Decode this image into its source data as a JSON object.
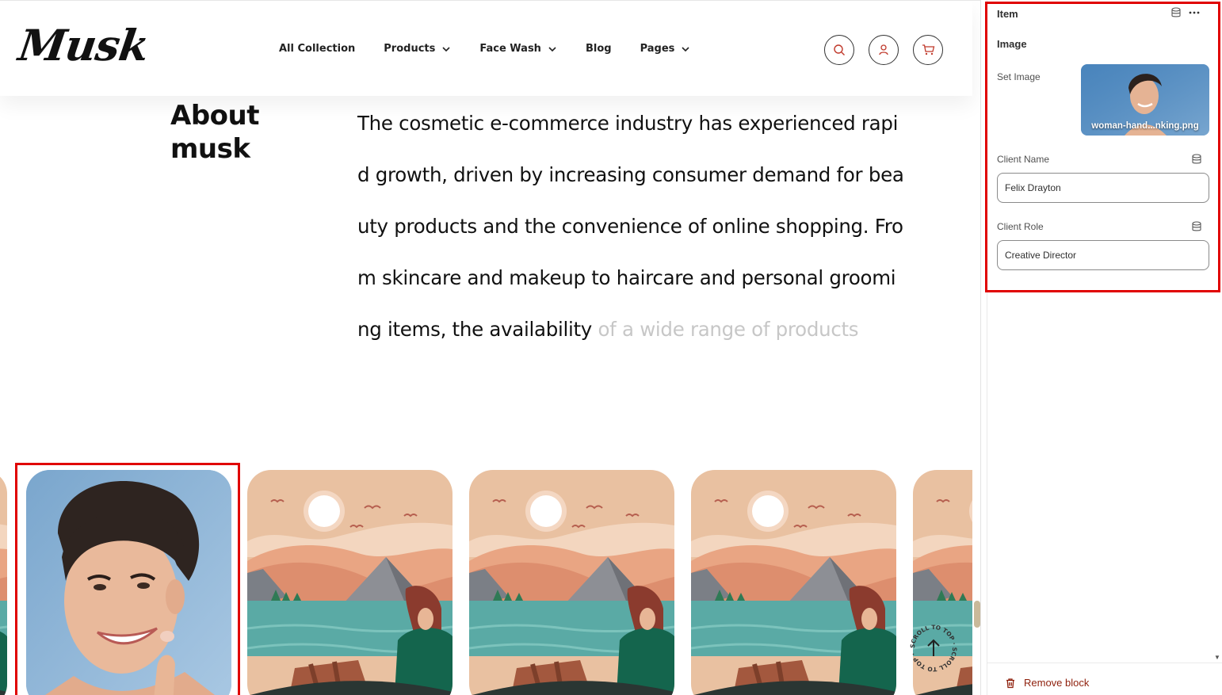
{
  "store": {
    "logo": "Musk",
    "nav": [
      {
        "label": "All Collection",
        "has_dropdown": false
      },
      {
        "label": "Products",
        "has_dropdown": true
      },
      {
        "label": "Face Wash",
        "has_dropdown": true
      },
      {
        "label": "Blog",
        "has_dropdown": false
      },
      {
        "label": "Pages",
        "has_dropdown": true
      }
    ],
    "header_icons": [
      "search-icon",
      "account-icon",
      "cart-icon"
    ],
    "about": {
      "title": "About musk",
      "text": "The cosmetic e-commerce industry has experienced rapid growth, driven by increasing consumer demand for beauty products and the convenience of online shopping. From skincare and makeup to haircare and personal grooming items, the availability",
      "faded_text": " of a wide range of products"
    },
    "scroll_top_label": "SCROLL TO TOP · SCROLL TO TOP ·"
  },
  "editor": {
    "title": "Item",
    "section": "Image",
    "set_image_label": "Set Image",
    "image_filename": "woman-hand...nking.png",
    "client_name_label": "Client Name",
    "client_name_value": "Felix Drayton",
    "client_role_label": "Client Role",
    "client_role_value": "Creative Director",
    "remove_label": "Remove block"
  },
  "colors": {
    "highlight": "#e00000",
    "remove": "#8e1f0b",
    "faded_text": "#c7c7c7"
  }
}
